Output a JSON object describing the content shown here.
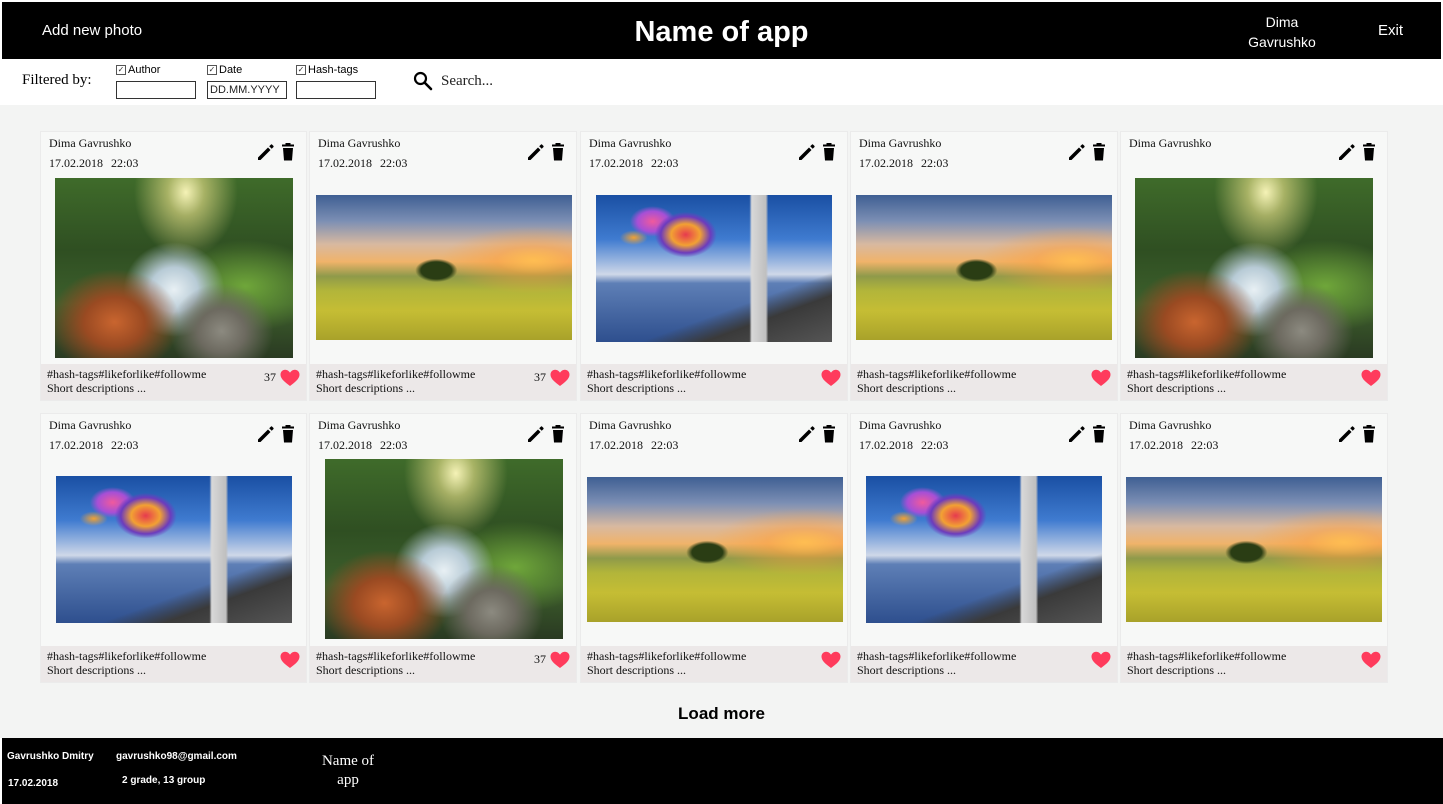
{
  "header": {
    "add_photo": "Add new photo",
    "app_title": "Name of app",
    "user_name": "Dima Gavrushko",
    "exit": "Exit"
  },
  "filters": {
    "label": "Filtered by:",
    "author": {
      "label": "Author",
      "checked": true,
      "value": ""
    },
    "date": {
      "label": "Date",
      "checked": true,
      "value": "DD.MM.YYYY"
    },
    "hashtags": {
      "label": "Hash-tags",
      "checked": true,
      "value": ""
    },
    "search_placeholder": "Search..."
  },
  "icons": {
    "edit": "pencil-icon",
    "delete": "trash-icon",
    "like": "heart-icon",
    "search": "search-icon"
  },
  "colors": {
    "header_bg": "#000000",
    "main_bg": "#f3f4f3",
    "card_footer_bg": "#ece8e8",
    "heart": "#ff3b5c"
  },
  "cards": [
    {
      "author": "Dima Gavrushko",
      "date": "17.02.2018",
      "time": "22:03",
      "image": "forest-stream",
      "tags": "#hash-tags#likeforlike#followme",
      "description": "Short descriptions ...",
      "likes": "37"
    },
    {
      "author": "Dima Gavrushko",
      "date": "17.02.2018",
      "time": "22:03",
      "image": "sunset-field",
      "tags": "#hash-tags#likeforlike#followme",
      "description": "Short descriptions ...",
      "likes": "37"
    },
    {
      "author": "Dima Gavrushko",
      "date": "17.02.2018",
      "time": "22:03",
      "image": "balloons-lighthouse",
      "tags": "#hash-tags#likeforlike#followme",
      "description": "Short descriptions ...",
      "likes": ""
    },
    {
      "author": "Dima Gavrushko",
      "date": "17.02.2018",
      "time": "22:03",
      "image": "sunset-field",
      "tags": "#hash-tags#likeforlike#followme",
      "description": "Short descriptions ...",
      "likes": ""
    },
    {
      "author": "Dima Gavrushko",
      "date": "",
      "time": "",
      "image": "forest-stream",
      "tags": "#hash-tags#likeforlike#followme",
      "description": "Short descriptions ...",
      "likes": ""
    },
    {
      "author": "Dima Gavrushko",
      "date": "17.02.2018",
      "time": "22:03",
      "image": "balloons-lighthouse",
      "tags": "#hash-tags#likeforlike#followme",
      "description": "Short descriptions ...",
      "likes": ""
    },
    {
      "author": "Dima Gavrushko",
      "date": "17.02.2018",
      "time": "22:03",
      "image": "forest-stream",
      "tags": "#hash-tags#likeforlike#followme",
      "description": "Short descriptions ...",
      "likes": "37"
    },
    {
      "author": "Dima Gavrushko",
      "date": "17.02.2018",
      "time": "22:03",
      "image": "sunset-field",
      "tags": "#hash-tags#likeforlike#followme",
      "description": "Short descriptions ...",
      "likes": ""
    },
    {
      "author": "Dima Gavrushko",
      "date": "17.02.2018",
      "time": "22:03",
      "image": "balloons-lighthouse",
      "tags": "#hash-tags#likeforlike#followme",
      "description": "Short descriptions ...",
      "likes": ""
    },
    {
      "author": "Dima Gavrushko",
      "date": "17.02.2018",
      "time": "22:03",
      "image": "sunset-field",
      "tags": "#hash-tags#likeforlike#followme",
      "description": "Short descriptions ...",
      "likes": ""
    }
  ],
  "load_more": "Load more",
  "footer": {
    "name": "Gavrushko Dmitry",
    "email": "gavrushko98@gmail.com",
    "date": "17.02.2018",
    "group": "2 grade, 13 group",
    "app_name": "Name of app"
  }
}
